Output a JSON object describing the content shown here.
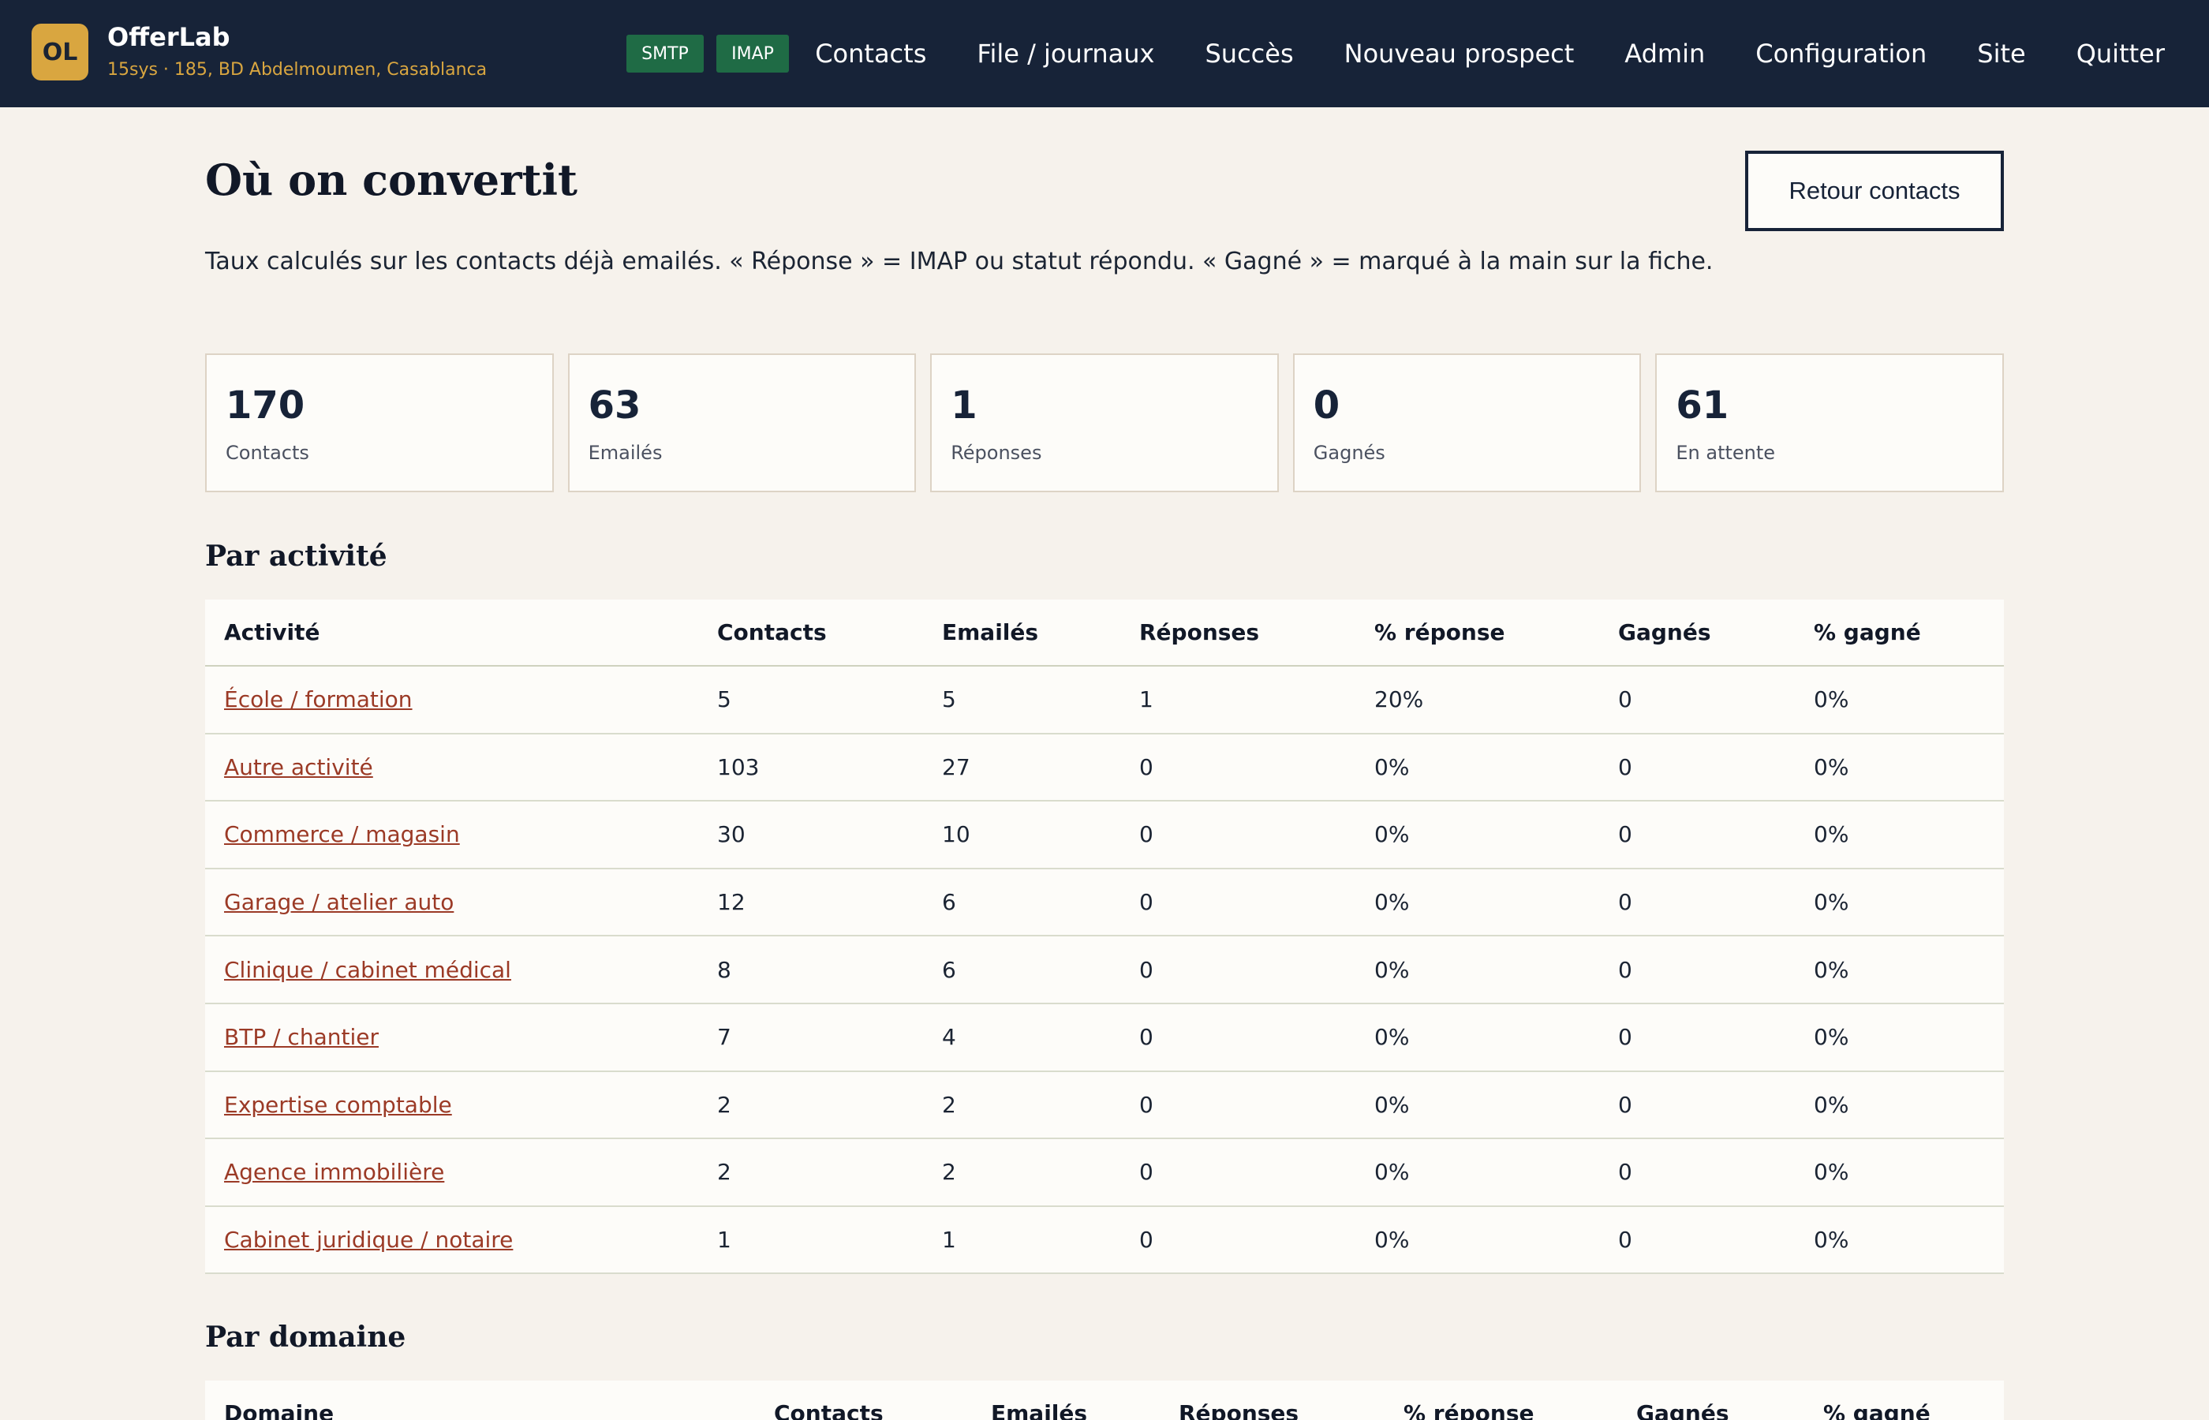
{
  "brand": {
    "badge": "OL",
    "name": "OfferLab",
    "subtitle": "15sys · 185, BD Abdelmoumen, Casablanca"
  },
  "status_pills": [
    "SMTP",
    "IMAP"
  ],
  "nav": [
    "Contacts",
    "File / journaux",
    "Succès",
    "Nouveau prospect",
    "Admin",
    "Configuration",
    "Site",
    "Quitter"
  ],
  "page": {
    "title": "Où on convertit",
    "description": "Taux calculés sur les contacts déjà emailés. « Réponse » = IMAP ou statut répondu. « Gagné » = marqué à la main sur la fiche.",
    "back_button": "Retour contacts"
  },
  "stats": [
    {
      "value": "170",
      "label": "Contacts"
    },
    {
      "value": "63",
      "label": "Emailés"
    },
    {
      "value": "1",
      "label": "Réponses"
    },
    {
      "value": "0",
      "label": "Gagnés"
    },
    {
      "value": "61",
      "label": "En attente"
    }
  ],
  "by_activity": {
    "title": "Par activité",
    "columns": [
      "Activité",
      "Contacts",
      "Emailés",
      "Réponses",
      "% réponse",
      "Gagnés",
      "% gagné"
    ],
    "rows": [
      [
        "École / formation",
        "5",
        "5",
        "1",
        "20%",
        "0",
        "0%"
      ],
      [
        "Autre activité",
        "103",
        "27",
        "0",
        "0%",
        "0",
        "0%"
      ],
      [
        "Commerce / magasin",
        "30",
        "10",
        "0",
        "0%",
        "0",
        "0%"
      ],
      [
        "Garage / atelier auto",
        "12",
        "6",
        "0",
        "0%",
        "0",
        "0%"
      ],
      [
        "Clinique / cabinet médical",
        "8",
        "6",
        "0",
        "0%",
        "0",
        "0%"
      ],
      [
        "BTP / chantier",
        "7",
        "4",
        "0",
        "0%",
        "0",
        "0%"
      ],
      [
        "Expertise comptable",
        "2",
        "2",
        "0",
        "0%",
        "0",
        "0%"
      ],
      [
        "Agence immobilière",
        "2",
        "2",
        "0",
        "0%",
        "0",
        "0%"
      ],
      [
        "Cabinet juridique / notaire",
        "1",
        "1",
        "0",
        "0%",
        "0",
        "0%"
      ]
    ]
  },
  "by_domain": {
    "title": "Par domaine",
    "columns": [
      "Domaine",
      "Contacts",
      "Emailés",
      "Réponses",
      "% réponse",
      "Gagnés",
      "% gagné"
    ]
  }
}
